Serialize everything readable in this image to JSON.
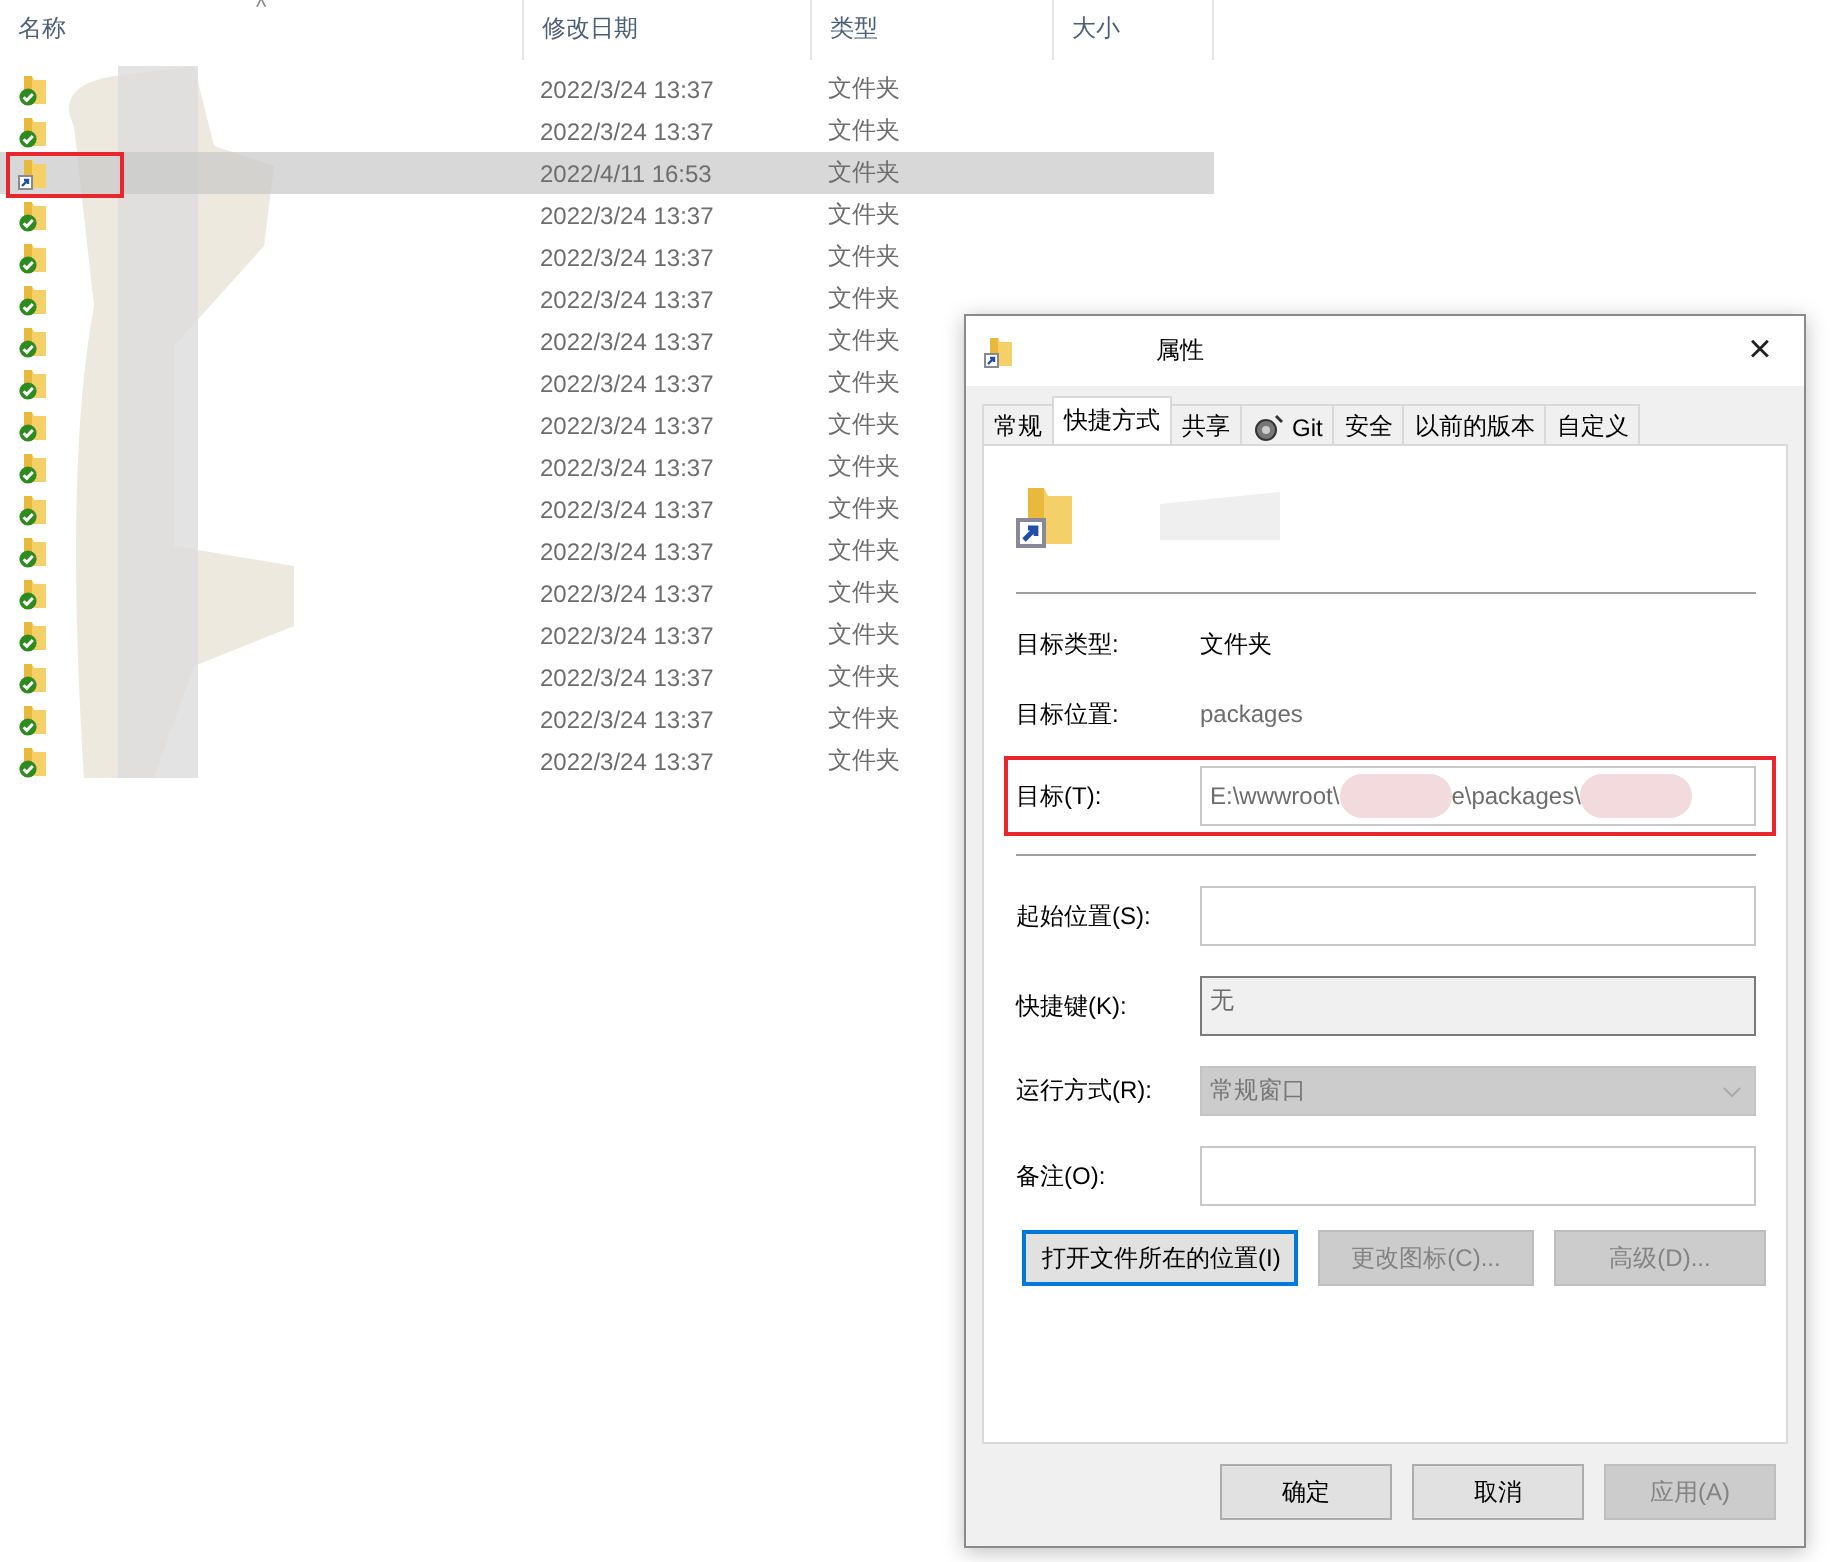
{
  "explorer": {
    "columns": [
      {
        "label": "名称",
        "sorted": true
      },
      {
        "label": "修改日期",
        "sorted": false
      },
      {
        "label": "类型",
        "sorted": false
      },
      {
        "label": "大小",
        "sorted": false
      }
    ],
    "sort_caret": "^",
    "rows": [
      {
        "kind": "synced",
        "date": "2022/3/24 13:37",
        "type": "文件夹",
        "selected": false,
        "highlighted": false
      },
      {
        "kind": "synced",
        "date": "2022/3/24 13:37",
        "type": "文件夹",
        "selected": false,
        "highlighted": false
      },
      {
        "kind": "shortcut",
        "date": "2022/4/11 16:53",
        "type": "文件夹",
        "selected": true,
        "highlighted": true
      },
      {
        "kind": "synced",
        "date": "2022/3/24 13:37",
        "type": "文件夹",
        "selected": false,
        "highlighted": false
      },
      {
        "kind": "synced",
        "date": "2022/3/24 13:37",
        "type": "文件夹",
        "selected": false,
        "highlighted": false
      },
      {
        "kind": "synced",
        "date": "2022/3/24 13:37",
        "type": "文件夹",
        "selected": false,
        "highlighted": false
      },
      {
        "kind": "synced",
        "date": "2022/3/24 13:37",
        "type": "文件夹",
        "selected": false,
        "highlighted": false
      },
      {
        "kind": "synced",
        "date": "2022/3/24 13:37",
        "type": "文件夹",
        "selected": false,
        "highlighted": false
      },
      {
        "kind": "synced",
        "date": "2022/3/24 13:37",
        "type": "文件夹",
        "selected": false,
        "highlighted": false
      },
      {
        "kind": "synced",
        "date": "2022/3/24 13:37",
        "type": "文件夹",
        "selected": false,
        "highlighted": false
      },
      {
        "kind": "synced",
        "date": "2022/3/24 13:37",
        "type": "文件夹",
        "selected": false,
        "highlighted": false
      },
      {
        "kind": "synced",
        "date": "2022/3/24 13:37",
        "type": "文件夹",
        "selected": false,
        "highlighted": false
      },
      {
        "kind": "synced",
        "date": "2022/3/24 13:37",
        "type": "文件夹",
        "selected": false,
        "highlighted": false
      },
      {
        "kind": "synced",
        "date": "2022/3/24 13:37",
        "type": "文件夹",
        "selected": false,
        "highlighted": false
      },
      {
        "kind": "synced",
        "date": "2022/3/24 13:37",
        "type": "文件夹",
        "selected": false,
        "highlighted": false
      },
      {
        "kind": "synced",
        "date": "2022/3/24 13:37",
        "type": "文件夹",
        "selected": false,
        "highlighted": false
      },
      {
        "kind": "synced",
        "date": "2022/3/24 13:37",
        "type": "文件夹",
        "selected": false,
        "highlighted": false
      }
    ]
  },
  "dialog": {
    "title": "属性",
    "close": "×",
    "tabs": [
      {
        "label": "常规",
        "selected": false
      },
      {
        "label": "快捷方式",
        "selected": true
      },
      {
        "label": "共享",
        "selected": false
      },
      {
        "label": "Git",
        "selected": false,
        "icon": true
      },
      {
        "label": "安全",
        "selected": false
      },
      {
        "label": "以前的版本",
        "selected": false
      },
      {
        "label": "自定义",
        "selected": false
      }
    ],
    "fields": [
      {
        "kind": "text",
        "label": "目标类型:",
        "value": "文件夹",
        "muted": false
      },
      {
        "kind": "text",
        "label": "目标位置:",
        "value": "packages",
        "muted": true
      },
      {
        "kind": "field",
        "label": "目标(T):",
        "value_parts": [
          "E:\\wwwroot\\",
          "e\\packages\\"
        ],
        "highlighted": true
      },
      {
        "kind": "separator"
      },
      {
        "kind": "field",
        "label": "起始位置(S):",
        "highlighted": false
      },
      {
        "kind": "readonly",
        "label": "快捷键(K):",
        "value": "无"
      },
      {
        "kind": "dropdown",
        "label": "运行方式(R):",
        "value": "常规窗口",
        "disabled": true
      },
      {
        "kind": "field",
        "label": "备注(O):",
        "highlighted": false
      }
    ],
    "actions": [
      {
        "label": "打开文件所在的位置(I)",
        "disabled": false,
        "focused": true
      },
      {
        "label": "更改图标(C)...",
        "disabled": true,
        "focused": false
      },
      {
        "label": "高级(D)...",
        "disabled": true,
        "focused": false
      }
    ],
    "buttons": [
      {
        "label": "确定",
        "disabled": false
      },
      {
        "label": "取消",
        "disabled": false
      },
      {
        "label": "应用(A)",
        "disabled": true
      }
    ]
  }
}
